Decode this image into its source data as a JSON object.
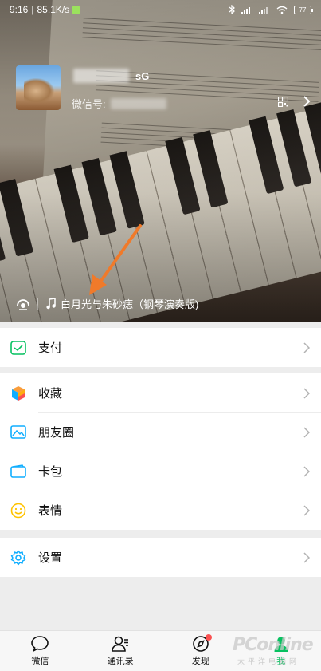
{
  "status_bar": {
    "time": "9:16",
    "speed": "85.1K/s",
    "battery": "77"
  },
  "profile": {
    "nickname_suffix": "sG",
    "wechat_id_label": "微信号:"
  },
  "status": {
    "music_title": "白月光与朱砂痣（钢琴演奏版)"
  },
  "menu": {
    "pay": "支付",
    "favorites": "收藏",
    "moments": "朋友圈",
    "cards": "卡包",
    "stickers": "表情",
    "settings": "设置"
  },
  "tabs": {
    "chats": "微信",
    "contacts": "通讯录",
    "discover": "发现",
    "me": "我"
  },
  "watermark": {
    "brand": "PConline",
    "sub": "太平洋电脑网"
  },
  "colors": {
    "accent": "#07c160",
    "arrow": "#f07a2a",
    "badge": "#fa5151",
    "background": "#ededed"
  }
}
